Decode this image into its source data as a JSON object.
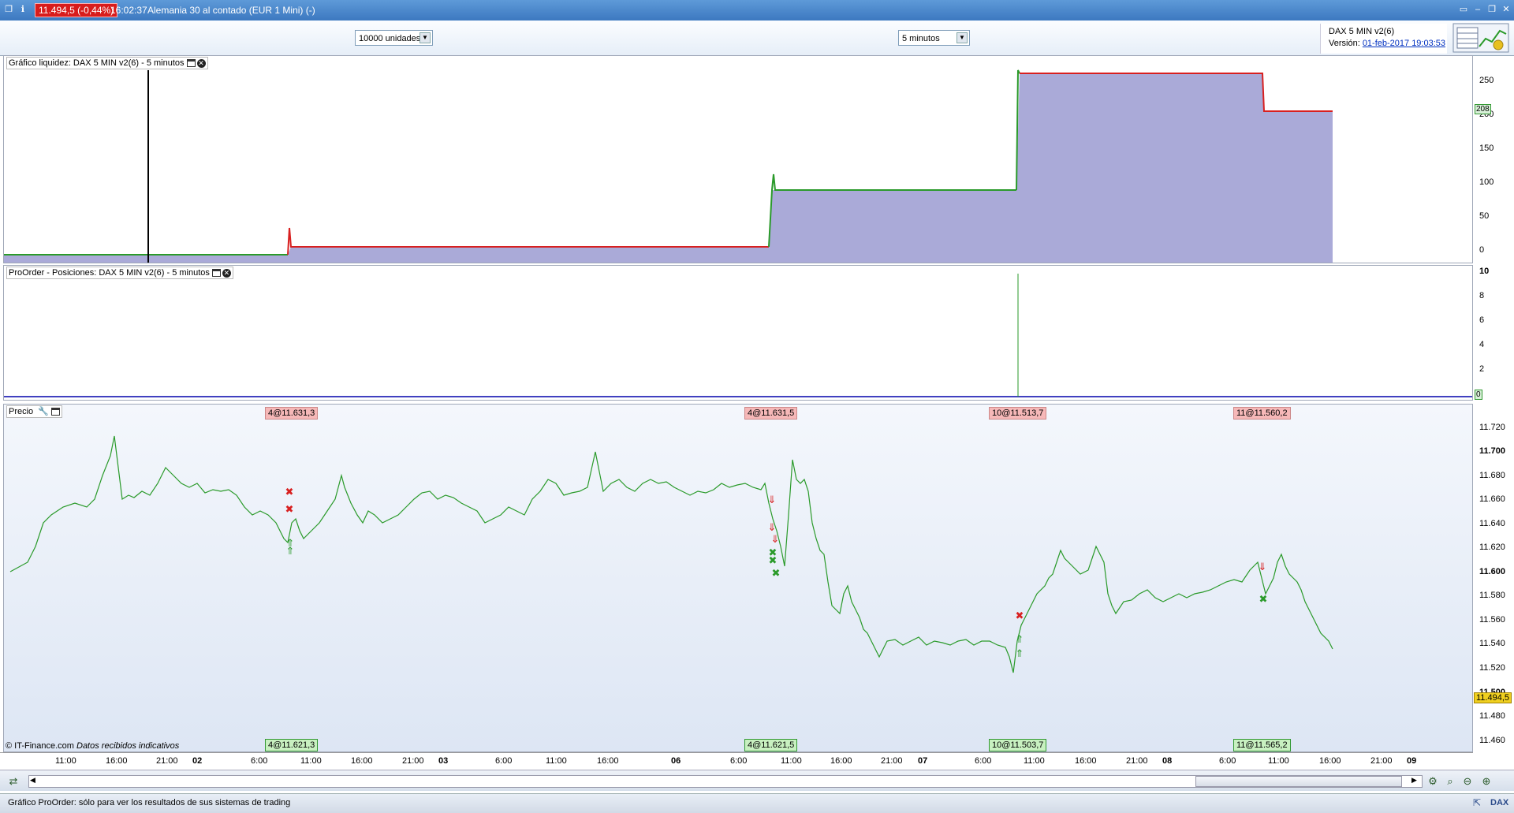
{
  "window": {
    "price_badge": "11.494,5 (-0,44%)",
    "time": "16:02:37",
    "instrument": "Alemania 30 al contado (EUR 1 Mini) (-)"
  },
  "toolbar": {
    "units_select": "10000 unidades",
    "timeframe_select": "5 minutos"
  },
  "system_info": {
    "name": "DAX 5 MIN v2(6)",
    "version_label": "Versión:",
    "version_date": "01-feb-2017 19:03:53"
  },
  "panels": {
    "equity": {
      "label": "Gráfico liquidez: DAX 5 MIN v2(6) - 5 minutos",
      "ticks": [
        "250",
        "200",
        "150",
        "100",
        "50",
        "0"
      ],
      "current": "208"
    },
    "positions": {
      "label": "ProOrder - Posiciones: DAX 5 MIN v2(6) - 5 minutos",
      "ticks": [
        "10",
        "8",
        "6",
        "4",
        "2"
      ],
      "current": "0"
    },
    "price": {
      "label": "Precio",
      "ticks": [
        "11.720",
        "11.700",
        "11.680",
        "11.660",
        "11.640",
        "11.620",
        "11.600",
        "11.580",
        "11.560",
        "11.540",
        "11.520",
        "11.500",
        "11.480",
        "11.460"
      ],
      "current": "11.494,5",
      "copyright": "© IT-Finance.com",
      "data_note": "Datos recibidos indicativos",
      "entries": [
        "4@11.631,3",
        "4@11.631,5",
        "10@11.513,7",
        "11@11.560,2"
      ],
      "exits": [
        "4@11.621,3",
        "4@11.621,5",
        "10@11.503,7",
        "11@11.565,2"
      ]
    }
  },
  "xaxis": [
    "11:00",
    "16:00",
    "21:00",
    "02",
    "6:00",
    "11:00",
    "16:00",
    "21:00",
    "03",
    "6:00",
    "11:00",
    "16:00",
    "06",
    "6:00",
    "11:00",
    "16:00",
    "21:00",
    "07",
    "6:00",
    "11:00",
    "16:00",
    "21:00",
    "08",
    "6:00",
    "11:00",
    "16:00",
    "21:00",
    "09"
  ],
  "status": "Gráfico ProOrder: sólo para ver los resultados de sus sistemas de trading",
  "colors": {
    "equity_fill": "#aaaad8",
    "equity_up": "#2a9a2a",
    "equity_down": "#d82020",
    "price_bg": "#e4ecf8",
    "title_bg": "#4a86cc"
  }
}
